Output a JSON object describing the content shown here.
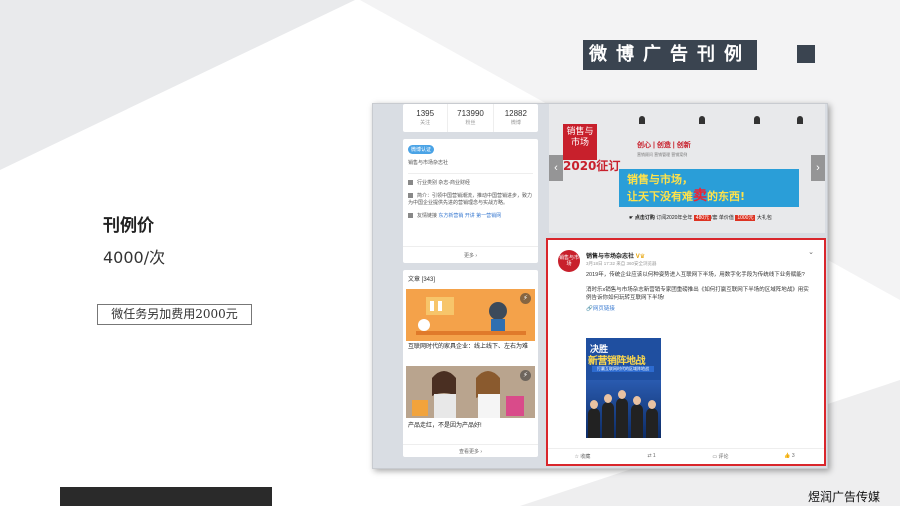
{
  "slide": {
    "title": "微博广告刊例",
    "price_heading": "刊例价",
    "price_value": "4000/次",
    "extra_fee": "微任务另加费用2000元",
    "brand": "煜润广告传媒"
  },
  "weibo": {
    "stats": [
      {
        "num": "1395",
        "label": "关注"
      },
      {
        "num": "713990",
        "label": "粉丝"
      },
      {
        "num": "12882",
        "label": "微博"
      }
    ],
    "verify_tag": "微博认证",
    "verify_name": "销售与市场杂志社",
    "industry": "行业类别  杂志-商业财经",
    "intro": "简介：引领中国营销潮流，推动中国营销进步，致力为中国企业提供先进的营销理念与实战方略。",
    "friend_link_label": "友情链接",
    "friend_links": "东方新营销  开讲  第一营销网",
    "info_more": "更多 ›",
    "articles_header": "文章 [343]",
    "articles": [
      {
        "title": "互联网时代的家具企业：线上线下、左右为难"
      },
      {
        "title": "产品走红，不是因为产品好!"
      }
    ],
    "articles_more": "查看更多 ›",
    "banner": {
      "logo": "销售与市场",
      "year": "2020征订",
      "cx": "创心 | 创造 | 创新",
      "cx_sub": "营销顾问   营销管理   营销案例",
      "slogan_a": "销售与市场，",
      "slogan_b": "让天下没有难",
      "slogan_big": "卖",
      "slogan_c": "的东西!",
      "strip_a": "点击订购",
      "strip_b": "订阅2020年全年",
      "strip_price1": "480元",
      "strip_c": "/套",
      "strip_d": "单价值",
      "strip_price2": "1000元",
      "strip_e": "大礼包"
    },
    "post": {
      "author": "销售与市场杂志社",
      "meta": "3月18日 17:32 来自 360安全浏览器",
      "para1": "2019年，传统企业应该以何种姿势进入互联网下半场，用数字化手段为传统线下业务赋能?",
      "para2": "消时乐x销售与市场杂志新营销专家团重磅推出《如何打赢互联网下半场的区域阵地战》用实例告诉你如何玩转互联网下半场!",
      "weblink": "网页链接",
      "poster_line1": "决胜",
      "poster_line2": "新营销阵地战",
      "poster_line3": "打赢互联网时代的区域阵地战",
      "actions": [
        "收藏",
        "1",
        "评论",
        "3"
      ]
    }
  }
}
